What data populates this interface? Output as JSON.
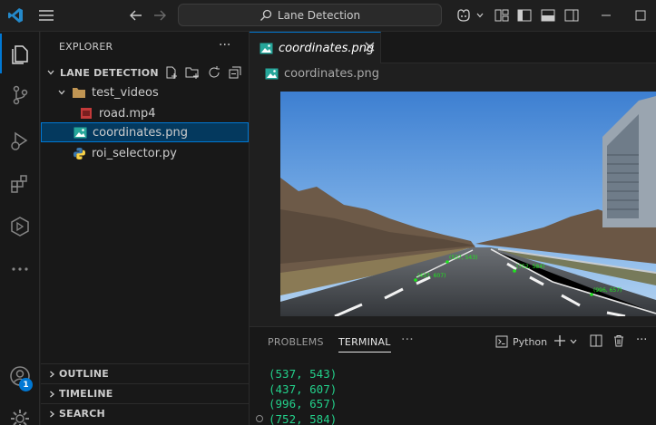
{
  "search": {
    "label": "Lane Detection"
  },
  "sidebar": {
    "header": "EXPLORER",
    "folder": "LANE DETECTION",
    "items": [
      {
        "label": "test_videos"
      },
      {
        "label": "road.mp4"
      },
      {
        "label": "coordinates.png"
      },
      {
        "label": "roi_selector.py"
      }
    ],
    "sections": [
      {
        "label": "OUTLINE"
      },
      {
        "label": "TIMELINE"
      },
      {
        "label": "SEARCH"
      }
    ]
  },
  "activity": {
    "accounts_badge": "1"
  },
  "editor": {
    "tab_label": "coordinates.png",
    "breadcrumb": "coordinates.png",
    "image_labels": [
      "(537, 543)",
      "(437, 607)",
      "(752, 584)",
      "(996, 657)"
    ]
  },
  "panel": {
    "tabs": [
      "PROBLEMS",
      "TERMINAL"
    ],
    "shell_label": "Python",
    "terminal_lines": [
      "(537, 543)",
      "(437, 607)",
      "(996, 657)",
      "(752, 584)"
    ]
  },
  "colors": {
    "accent": "#0078d4",
    "terminal_green": "#23d18b",
    "selection": "#04395e"
  }
}
